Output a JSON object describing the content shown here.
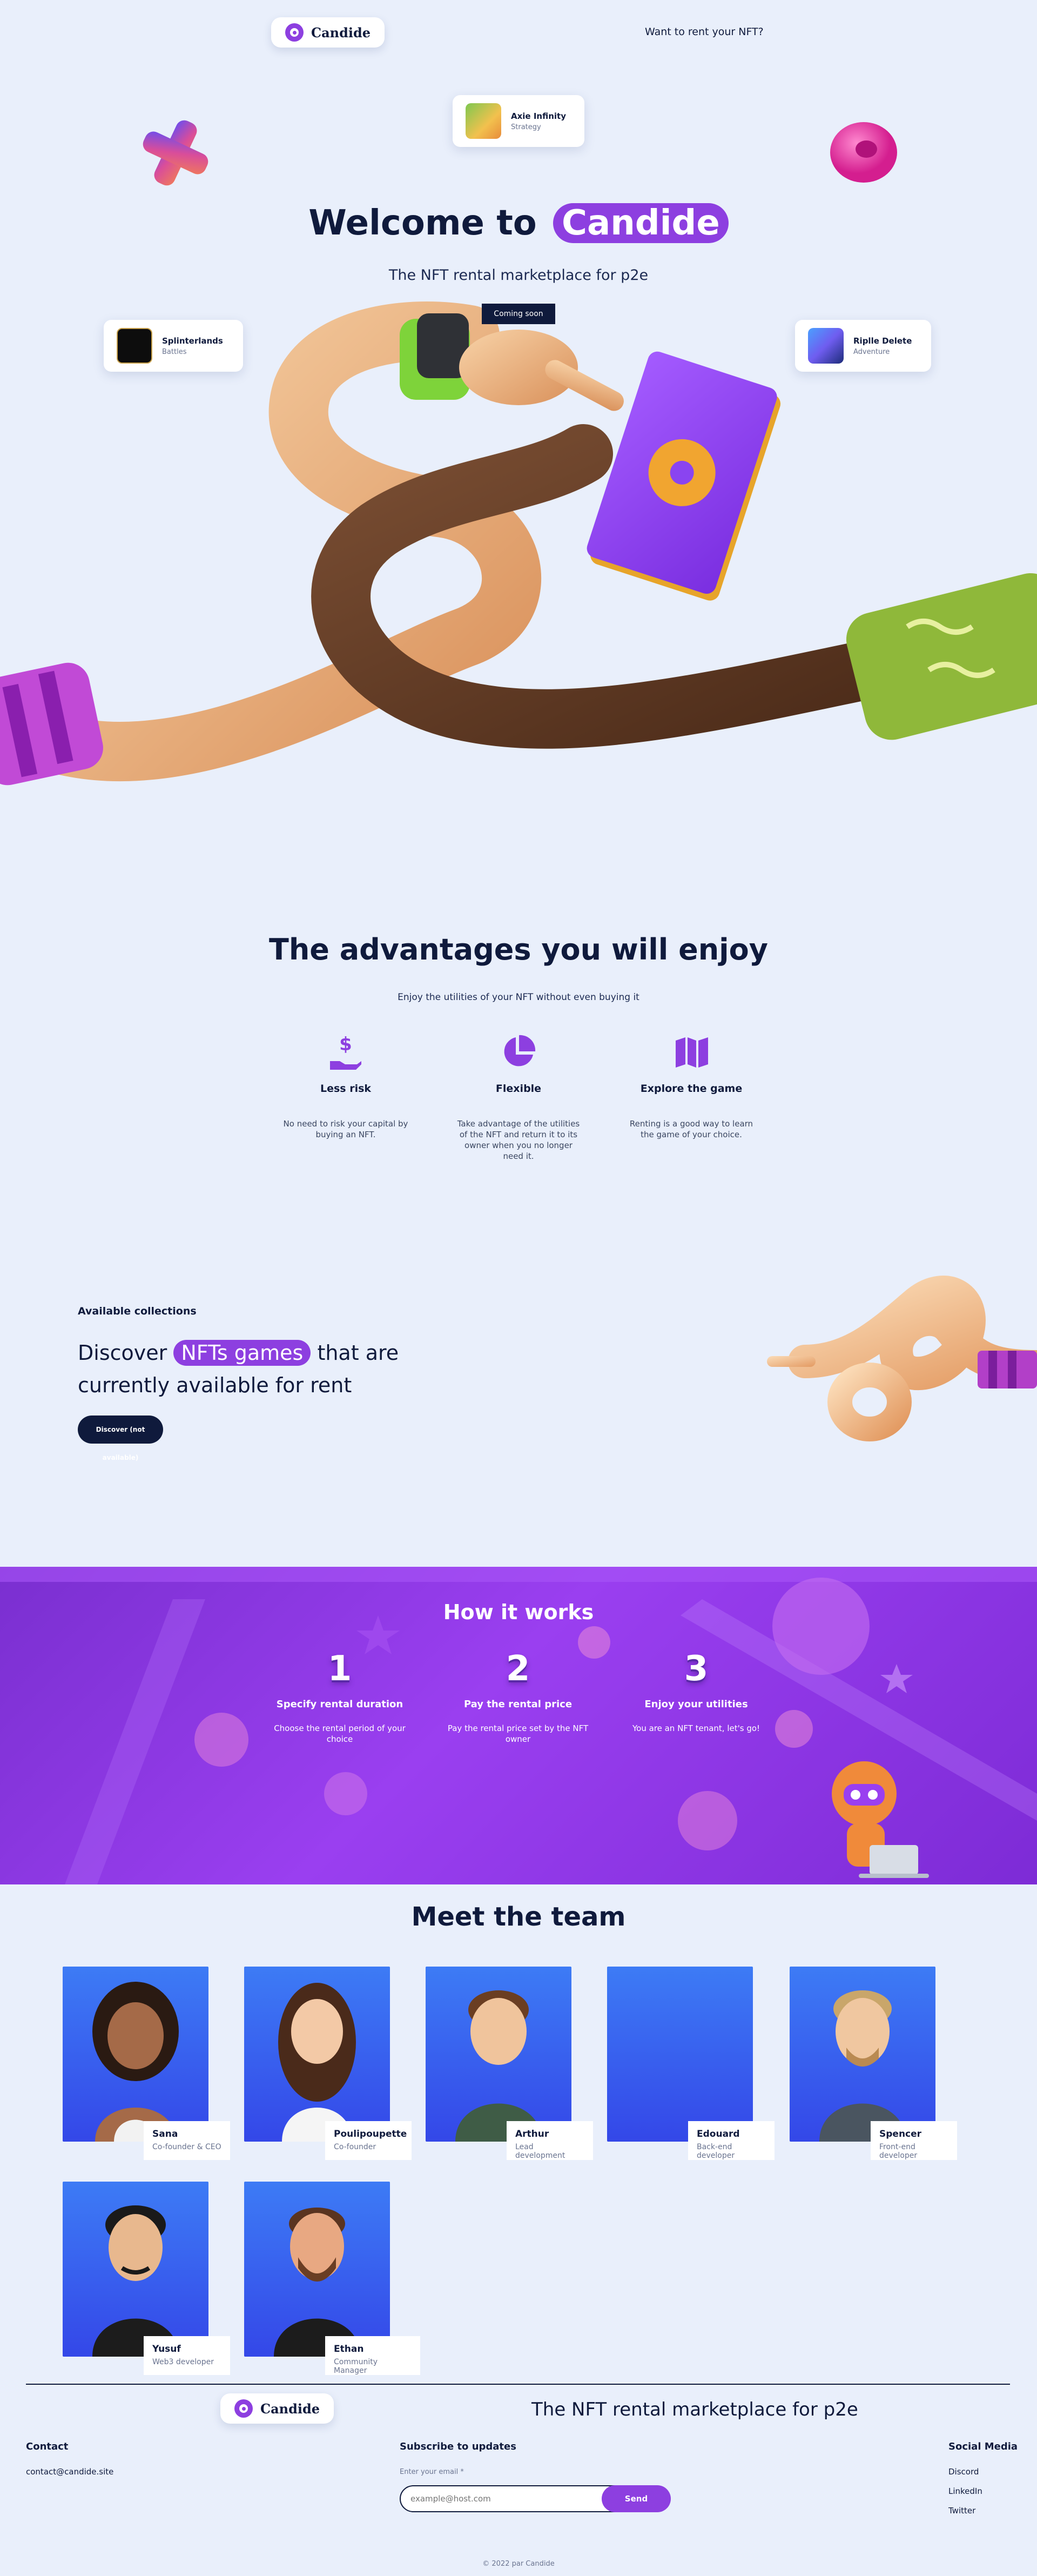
{
  "header": {
    "logo_text": "Candide",
    "rent_link": "Want to rent your NFT?"
  },
  "hero": {
    "title_prefix": "Welcome to",
    "title_highlight": "Candide",
    "subtitle": "The NFT rental marketplace for p2e",
    "coming_soon": "Coming soon",
    "games": [
      {
        "name": "Axie Infinity",
        "category": "Strategy"
      },
      {
        "name": "Splinterlands",
        "category": "Battles"
      },
      {
        "name": "Riplle Delete",
        "category": "Adventure"
      }
    ]
  },
  "advantages": {
    "title": "The advantages you will enjoy",
    "subtitle": "Enjoy the utilities of your NFT without even buying it",
    "items": [
      {
        "icon": "hand-dollar-icon",
        "title": "Less risk",
        "desc": "No need to risk your capital by buying an NFT."
      },
      {
        "icon": "pie-chart-icon",
        "title": "Flexible",
        "desc": "Take advantage of the utilities of the NFT and return it to its owner when you no longer need it."
      },
      {
        "icon": "map-icon",
        "title": "Explore the game",
        "desc": "Renting is a good way to learn the game of your choice."
      }
    ]
  },
  "collections": {
    "label": "Available collections",
    "title_prefix": "Discover",
    "title_highlight": "NFTs games",
    "title_suffix": "that are",
    "title_line2": "currently available for rent",
    "button": "Discover (not available)"
  },
  "how": {
    "title": "How it works",
    "steps": [
      {
        "num": "1",
        "title": "Specify rental duration",
        "desc": "Choose the rental period of your choice"
      },
      {
        "num": "2",
        "title": "Pay the rental price",
        "desc": "Pay the rental price set by the NFT owner"
      },
      {
        "num": "3",
        "title": "Enjoy your utilities",
        "desc": "You are an NFT tenant, let's go!"
      }
    ]
  },
  "team": {
    "title": "Meet the team",
    "members": [
      {
        "name": "Sana",
        "role": "Co-founder & CEO"
      },
      {
        "name": "Poulipoupette",
        "role": "Co-founder"
      },
      {
        "name": "Arthur",
        "role": "Lead development"
      },
      {
        "name": "Edouard",
        "role": "Back-end developer"
      },
      {
        "name": "Spencer",
        "role": "Front-end developer"
      },
      {
        "name": "Yusuf",
        "role": "Web3 developer"
      },
      {
        "name": "Ethan",
        "role": "Community Manager"
      }
    ]
  },
  "footer": {
    "logo_text": "Candide",
    "tagline": "The NFT rental marketplace for p2e",
    "contact_title": "Contact",
    "contact_email": "contact@candide.site",
    "subscribe_title": "Subscribe to updates",
    "email_label": "Enter your email *",
    "email_placeholder": "example@host.com",
    "send": "Send",
    "social_title": "Social Media",
    "social": [
      "Discord",
      "LinkedIn",
      "Twitter"
    ],
    "copyright": "© 2022 par Candide"
  },
  "colors": {
    "accent": "#8d3fe0",
    "navy": "#0f1a3c",
    "background": "#e9effb"
  }
}
